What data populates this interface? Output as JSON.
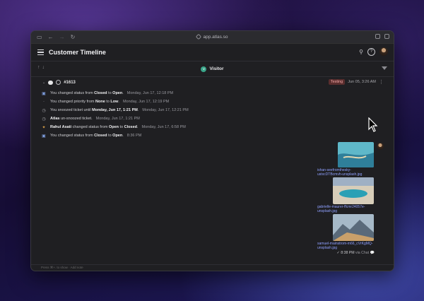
{
  "browser": {
    "url": "app.atlas.so"
  },
  "header": {
    "title": "Customer Timeline"
  },
  "subheader": {
    "visitor_label": "Visitor",
    "visitor_initial": "V"
  },
  "ticket": {
    "id": "#1613",
    "tag": "Testing",
    "date": "Jun 05, 3:26 AM"
  },
  "events": [
    {
      "icon": "status-icon",
      "parts": [
        [
          "You changed status from ",
          false
        ],
        [
          "Closed",
          true
        ],
        [
          " to ",
          false
        ],
        [
          "Open",
          true
        ],
        [
          ".",
          false
        ]
      ],
      "time": "Monday, Jun 17, 12:18 PM"
    },
    {
      "icon": "priority-icon",
      "parts": [
        [
          "You changed priority from ",
          false
        ],
        [
          "None",
          true
        ],
        [
          " to ",
          false
        ],
        [
          "Low",
          true
        ],
        [
          ".",
          false
        ]
      ],
      "time": "Monday, Jun 17, 12:19 PM"
    },
    {
      "icon": "clock-icon",
      "parts": [
        [
          "You snoozed ticket until ",
          false
        ],
        [
          "Monday, Jun 17, 1:21 PM",
          true
        ],
        [
          ".",
          false
        ]
      ],
      "time": "Monday, Jun 17, 12:21 PM"
    },
    {
      "icon": "clock-icon",
      "parts": [
        [
          "Atlas",
          true
        ],
        [
          " un-snoozed ticket.",
          false
        ]
      ],
      "time": "Monday, Jun 17, 1:21 PM"
    },
    {
      "icon": "party-icon",
      "parts": [
        [
          "Rahul Asati",
          true
        ],
        [
          " changed status from ",
          false
        ],
        [
          "Open",
          true
        ],
        [
          " to ",
          false
        ],
        [
          "Closed",
          true
        ],
        [
          ".",
          false
        ]
      ],
      "time": "Monday, Jun 17, 6:58 PM"
    },
    {
      "icon": "status-icon",
      "parts": [
        [
          "You changed status from ",
          false
        ],
        [
          "Closed",
          true
        ],
        [
          " to ",
          false
        ],
        [
          "Open",
          true
        ],
        [
          ".",
          false
        ]
      ],
      "time": "8:36 PM"
    }
  ],
  "attachments": [
    {
      "caption": "ishan-seefromthesky-ustxcDTBcmvh-unsplash.jpg",
      "colors": [
        "#5fb8c9",
        "#2f7f9a",
        "#e2d7b0"
      ]
    },
    {
      "caption": "gabrielle-maurer-ffcmr24057e-unsplash.jpg",
      "colors": [
        "#d7cdb9",
        "#2aa0b5",
        "#9fb0c4"
      ]
    },
    {
      "caption": "samuel-mainstrom-m66_cVrKgMQ-unsplash.jpg",
      "colors": [
        "#a6b9c8",
        "#5a6a7a",
        "#c9a06a"
      ]
    }
  ],
  "message_meta": {
    "time": "8:38 PM",
    "via": "via Chat"
  },
  "bottom_bar": {
    "text": "Press ⌘+. to show  ·  Add note"
  }
}
